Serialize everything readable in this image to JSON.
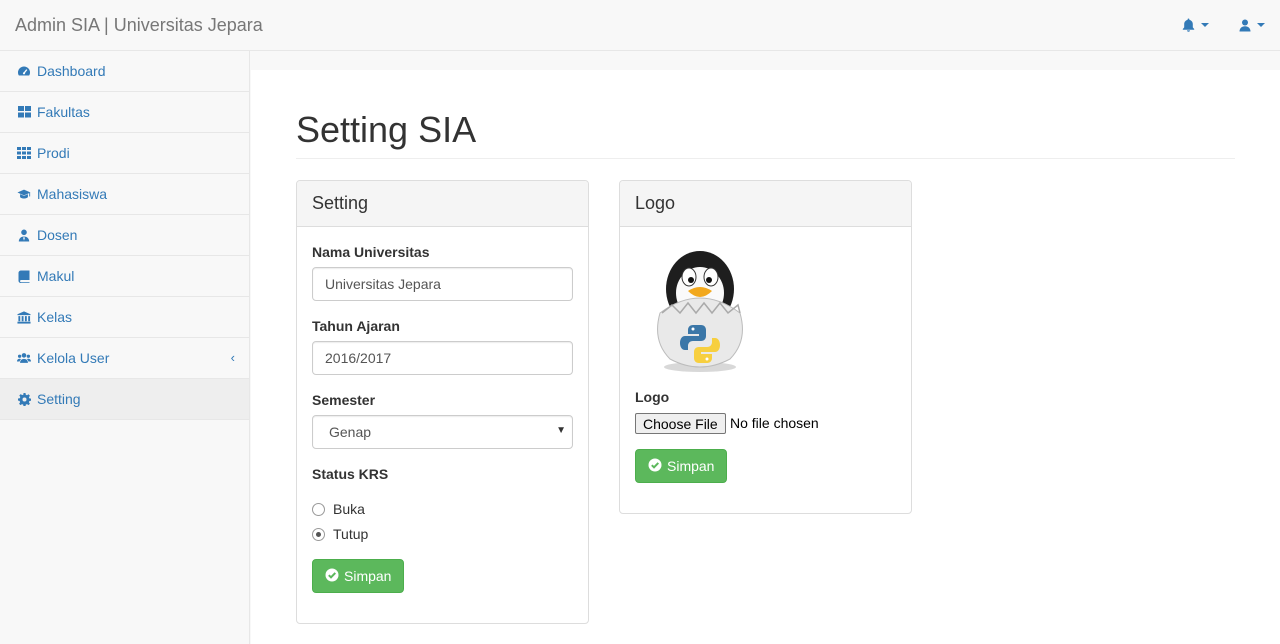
{
  "navbar": {
    "brand": "Admin SIA | Universitas Jepara",
    "bell_icon": "bell-icon",
    "user_icon": "user-icon"
  },
  "sidebar": {
    "items": [
      {
        "label": "Dashboard",
        "icon": "dashboard-icon"
      },
      {
        "label": "Fakultas",
        "icon": "grid-large-icon"
      },
      {
        "label": "Prodi",
        "icon": "grid-small-icon"
      },
      {
        "label": "Mahasiswa",
        "icon": "graduation-cap-icon"
      },
      {
        "label": "Dosen",
        "icon": "user-tie-icon"
      },
      {
        "label": "Makul",
        "icon": "book-icon"
      },
      {
        "label": "Kelas",
        "icon": "institution-icon"
      },
      {
        "label": "Kelola User",
        "icon": "users-icon"
      },
      {
        "label": "Setting",
        "icon": "gear-icon"
      }
    ],
    "active": "Setting",
    "chevron": "‹"
  },
  "page": {
    "title": "Setting SIA"
  },
  "setting_panel": {
    "heading": "Setting",
    "nama_label": "Nama Universitas",
    "nama_value": "Universitas Jepara",
    "tahun_label": "Tahun Ajaran",
    "tahun_value": "2016/2017",
    "semester_label": "Semester",
    "semester_value": "Genap",
    "status_label": "Status KRS",
    "status_options": [
      {
        "label": "Buka",
        "checked": false
      },
      {
        "label": "Tutup",
        "checked": true
      }
    ],
    "save_label": "Simpan"
  },
  "logo_panel": {
    "heading": "Logo",
    "field_label": "Logo",
    "choose_file_label": "Choose File",
    "no_file_text": "No file chosen",
    "save_label": "Simpan"
  },
  "colors": {
    "link": "#337ab7",
    "success": "#5cb85c",
    "panel_heading_bg": "#f5f5f5"
  }
}
